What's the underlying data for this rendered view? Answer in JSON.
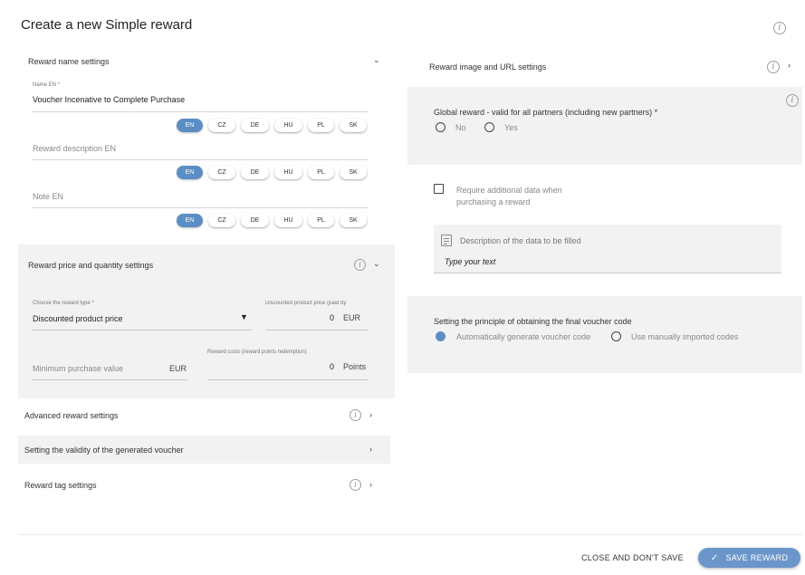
{
  "page": {
    "title": "Create a new Simple reward"
  },
  "left": {
    "name_section": {
      "title": "Reward name settings",
      "name_label": "Name EN  *",
      "name_value": "Voucher Incenative to Complete Purchase",
      "description_placeholder": "Reward description EN",
      "note_placeholder": "Note EN",
      "languages": [
        "EN",
        "CZ",
        "DE",
        "HU",
        "PL",
        "SK"
      ]
    },
    "price_section": {
      "title": "Reward price and quantity settings",
      "type_label": "Choose the reward type *",
      "type_value": "Discounted product price",
      "discount_label": "Discounted product price (paid by",
      "discount_value": "0",
      "discount_unit": "EUR",
      "min_purchase_placeholder": "Minimum purchase value",
      "min_purchase_unit": "EUR",
      "costs_label": "Reward costs (reward points redemption)",
      "costs_value": "0",
      "costs_unit": "Points"
    },
    "advanced": {
      "title": "Advanced reward settings"
    },
    "validity": {
      "title": "Setting the validity of the generated voucher"
    },
    "tags": {
      "title": "Reward tag settings"
    }
  },
  "right": {
    "image_section": {
      "title": "Reward image and URL settings"
    },
    "global": {
      "label": "Global reward - valid for all partners (including new partners) *",
      "no": "No",
      "yes": "Yes"
    },
    "require": {
      "line1": "Require additional data when",
      "line2": "purchasing a reward"
    },
    "description_box": {
      "label": "Description of the data to be filled",
      "value": "Type your text"
    },
    "voucher_code": {
      "label": "Setting the principle of obtaining the final voucher code",
      "auto": "Automatically generate voucher code",
      "manual": "Use manually imported codes",
      "selected": "auto"
    }
  },
  "footer": {
    "close_label": "CLOSE AND DON'T SAVE",
    "save_label": "SAVE REWARD"
  },
  "colors": {
    "accent": "#5c8ec4",
    "panel_bg": "#f2f2f2"
  }
}
